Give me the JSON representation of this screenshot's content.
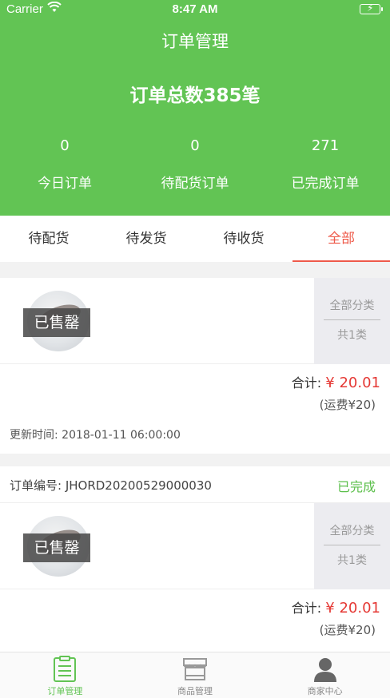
{
  "status_bar": {
    "carrier": "Carrier",
    "time": "8:47 AM"
  },
  "header": {
    "title": "订单管理",
    "summary": "订单总数385笔",
    "stats": [
      {
        "value": "0",
        "label": "今日订单"
      },
      {
        "value": "0",
        "label": "待配货订单"
      },
      {
        "value": "271",
        "label": "已完成订单"
      }
    ],
    "bg_color": "#62c454"
  },
  "tabs": [
    {
      "label": "待配货",
      "active": false
    },
    {
      "label": "待发货",
      "active": false
    },
    {
      "label": "待收货",
      "active": false
    },
    {
      "label": "全部",
      "active": true
    }
  ],
  "orders": [
    {
      "sold_badge": "已售罄",
      "category_title": "全部分类",
      "category_count": "共1类",
      "total_label": "合计:",
      "total_amount": "¥ 20.01",
      "freight": "(运费¥20)",
      "updated": "更新时间: 2018-01-11 06:00:00"
    },
    {
      "order_no": "订单编号: JHORD20200529000030",
      "status": "已完成",
      "sold_badge": "已售罄",
      "category_title": "全部分类",
      "category_count": "共1类",
      "total_label": "合计:",
      "total_amount": "¥ 20.01",
      "freight": "(运费¥20)"
    }
  ],
  "tabbar": [
    {
      "label": "订单管理",
      "icon": "clipboard-icon",
      "active": true
    },
    {
      "label": "商品管理",
      "icon": "store-icon",
      "active": false
    },
    {
      "label": "商家中心",
      "icon": "person-icon",
      "active": false
    }
  ],
  "colors": {
    "accent": "#ee5a4a",
    "price": "#e53935",
    "success": "#5bbf4a"
  }
}
